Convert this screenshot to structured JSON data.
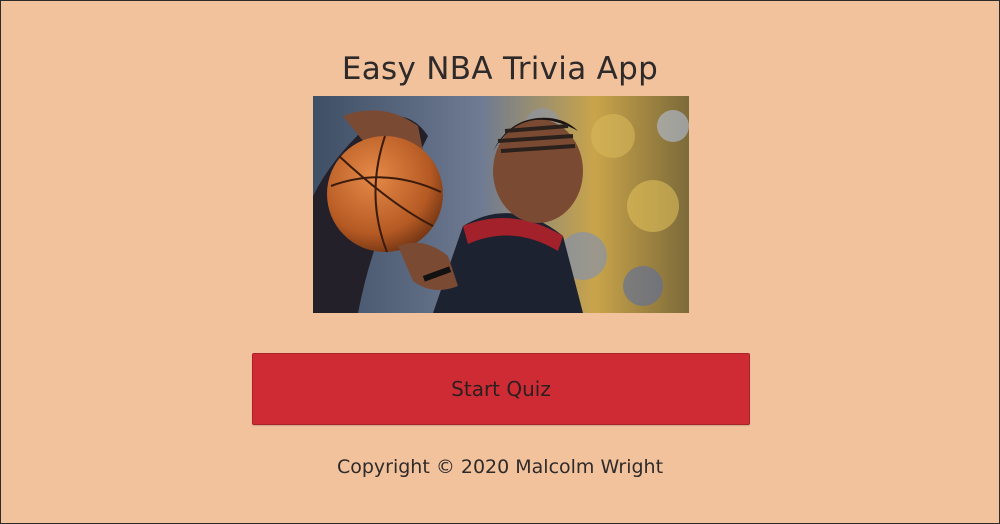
{
  "header": {
    "title": "Easy NBA Trivia App"
  },
  "hero": {
    "description_icon": "basketball-player-photo"
  },
  "actions": {
    "start_label": "Start Quiz"
  },
  "footer": {
    "copyright": "Copyright © 2020 Malcolm Wright"
  },
  "colors": {
    "background": "#f2c29d",
    "button": "#cf2b35",
    "text": "#2f2a2a"
  }
}
